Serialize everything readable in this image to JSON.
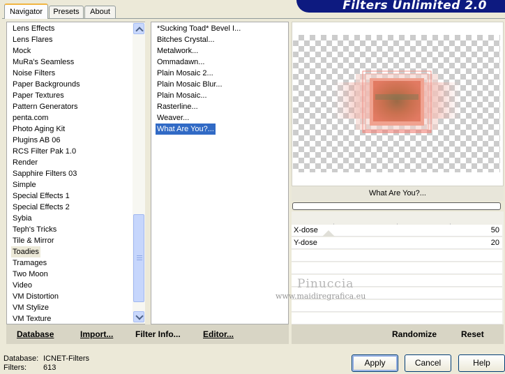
{
  "tabs": [
    {
      "label": "Navigator",
      "active": true
    },
    {
      "label": "Presets",
      "active": false
    },
    {
      "label": "About",
      "active": false
    }
  ],
  "banner": {
    "title": "Filters Unlimited 2.0"
  },
  "categories": [
    "Lens Effects",
    "Lens Flares",
    "Mock",
    "MuRa's Seamless",
    "Noise Filters",
    "Paper Backgrounds",
    "Paper Textures",
    "Pattern Generators",
    "penta.com",
    "Photo Aging Kit",
    "Plugins AB 06",
    "RCS Filter Pak 1.0",
    "Render",
    "Sapphire Filters 03",
    "Simple",
    "Special Effects 1",
    "Special Effects 2",
    "Sybia",
    "Teph's Tricks",
    "Tile & Mirror",
    "Toadies",
    "Tramages",
    "Two Moon",
    "Video",
    "VM Distortion",
    "VM Stylize",
    "VM Texture"
  ],
  "filters": [
    "*Sucking Toad*  Bevel I...",
    "Bitches Crystal...",
    "Metalwork...",
    "Ommadawn...",
    "Plain Mosaic 2...",
    "Plain Mosaic Blur...",
    "Plain Mosaic...",
    "Rasterline...",
    "Weaver...",
    "What Are You?..."
  ],
  "selected_category": "Toadies",
  "selected_filter": "What Are You?...",
  "preview": {
    "filter_name": "What Are You?..."
  },
  "params": [
    {
      "name": "X-dose",
      "value": "50"
    },
    {
      "name": "Y-dose",
      "value": "20"
    }
  ],
  "watermark": {
    "line1": "Pinuccia",
    "line2": "www.maidiregrafica.eu"
  },
  "toolbar_left": {
    "database": "Database",
    "import": "Import...",
    "filter_info": "Filter Info...",
    "editor": "Editor..."
  },
  "toolbar_right": {
    "randomize": "Randomize",
    "reset": "Reset"
  },
  "status": {
    "database_label": "Database:",
    "database_value": "ICNET-Filters",
    "filters_label": "Filters:",
    "filters_value": "613"
  },
  "buttons": {
    "apply": "Apply",
    "cancel": "Cancel",
    "help": "Help"
  },
  "colors": {
    "selection": "#316ac5",
    "banner": "#0d1a80",
    "dialog": "#ece9d8"
  }
}
